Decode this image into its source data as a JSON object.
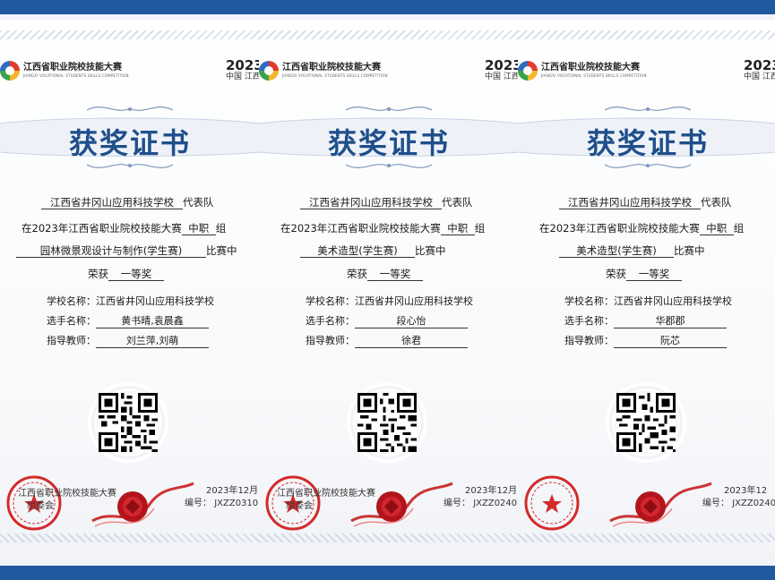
{
  "event": {
    "name": "江西省职业院校技能大赛",
    "name_en": "JIANGXI VOCATIONAL STUDENTS SKILLS COMPETITION",
    "year": "2023",
    "location": "中国 江西",
    "organizer_line1": "江西省职业院校技能大赛",
    "organizer_line2": "组委会"
  },
  "labels": {
    "title": "获奖证书",
    "team_suffix": "代表队",
    "in_prefix": "在",
    "group_suffix": "组",
    "event_suffix": "比赛中",
    "award_prefix": "荣获",
    "school_label": "学校名称：",
    "player_label": "选手名称：",
    "teacher_label": "指导教师：",
    "cert_no_label": "编号："
  },
  "colors": {
    "brand_blue": "#1f5a9e",
    "title_blue": "#1f4f8b",
    "seal_red": "#d42a2a",
    "wax_red": "#b3141c"
  },
  "certificates": [
    {
      "school": "江西省井冈山应用科技学校",
      "competition": "2023年江西省职业院校技能大赛",
      "level": "中职",
      "event": "园林微景观设计与制作(学生赛)",
      "award": "一等奖",
      "school_full": "江西省井冈山应用科技学校",
      "players": "黄书晴,袁晨鑫",
      "teachers": "刘兰萍,刘萌",
      "date": "2023年12月",
      "cert_no": "JXZZ0310"
    },
    {
      "school": "江西省井冈山应用科技学校",
      "competition": "2023年江西省职业院校技能大赛",
      "level": "中职",
      "event": "美术造型(学生赛)",
      "award": "一等奖",
      "school_full": "江西省井冈山应用科技学校",
      "players": "段心怡",
      "teachers": "徐君",
      "date": "2023年12月",
      "cert_no": "JXZZ0240"
    },
    {
      "school": "江西省井冈山应用科技学校",
      "competition": "2023年江西省职业院校技能大赛",
      "level": "中职",
      "event": "美术造型(学生赛)",
      "award": "一等奖",
      "school_full": "江西省井冈山应用科技学校",
      "players": "华郡郡",
      "teachers": "阮芯",
      "date": "2023年12",
      "cert_no": "JXZZ0240"
    }
  ]
}
